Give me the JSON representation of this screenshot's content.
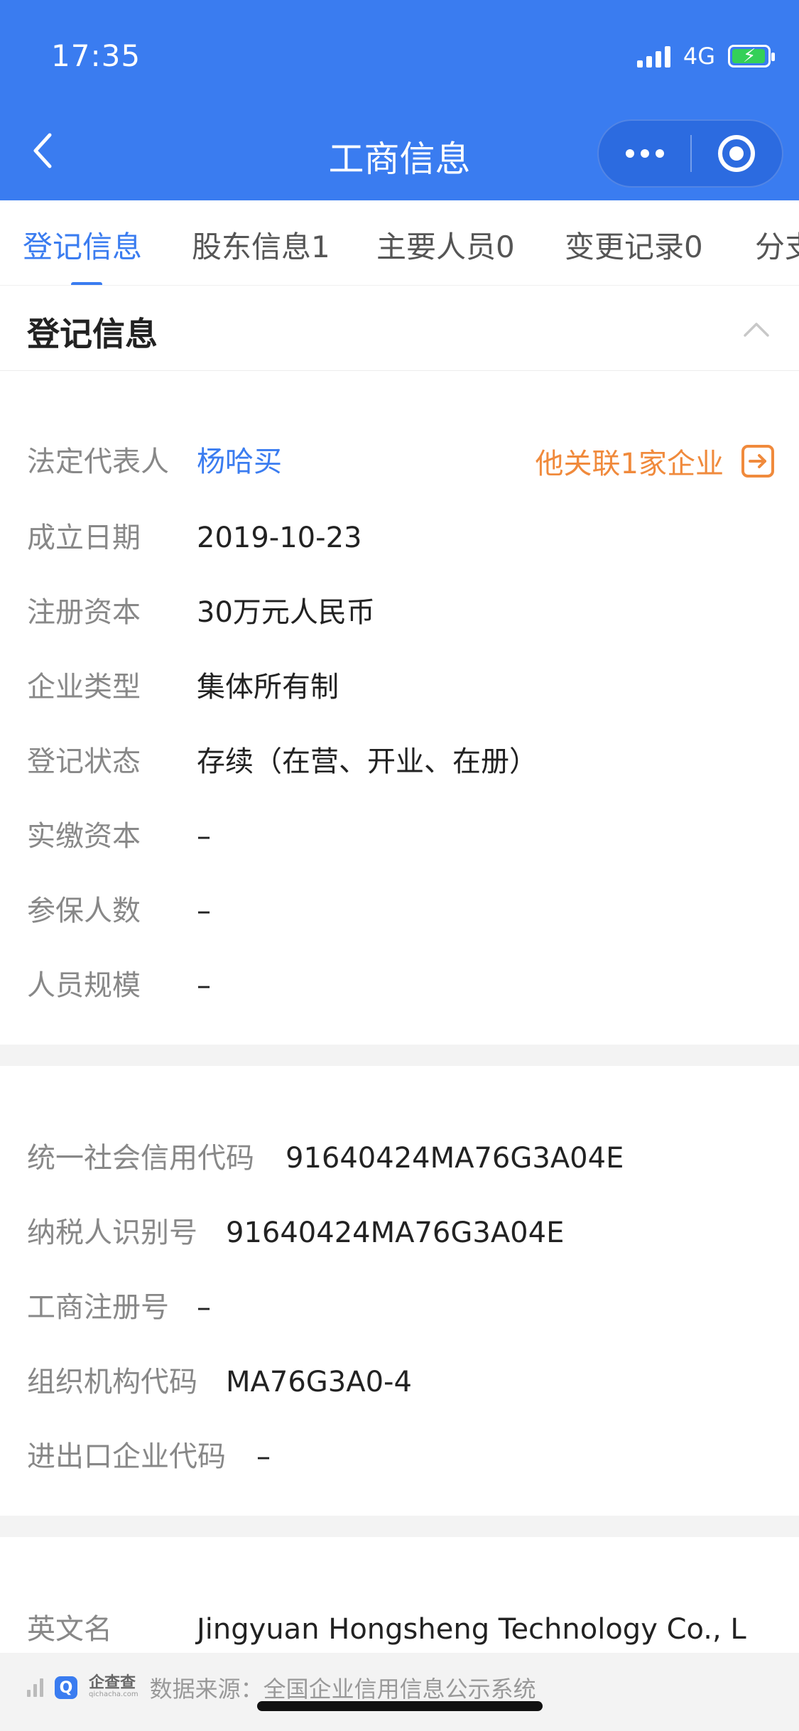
{
  "status": {
    "time": "17:35",
    "network": "4G"
  },
  "nav": {
    "title": "工商信息"
  },
  "tabs": [
    {
      "label": "登记信息"
    },
    {
      "label": "股东信息1"
    },
    {
      "label": "主要人员0"
    },
    {
      "label": "变更记录0"
    },
    {
      "label": "分支"
    }
  ],
  "section": {
    "title": "登记信息"
  },
  "registration": {
    "legal_rep_label": "法定代表人",
    "legal_rep_value": "杨哈买",
    "related_link": "他关联1家企业",
    "found_date_label": "成立日期",
    "found_date_value": "2019-10-23",
    "capital_label": "注册资本",
    "capital_value": "30万元人民币",
    "type_label": "企业类型",
    "type_value": "集体所有制",
    "status_label": "登记状态",
    "status_value": "存续（在营、开业、在册）",
    "paid_label": "实缴资本",
    "paid_value": "–",
    "insured_label": "参保人数",
    "insured_value": "–",
    "scale_label": "人员规模",
    "scale_value": "–"
  },
  "codes": {
    "credit_label": "统一社会信用代码",
    "credit_value": "91640424MA76G3A04E",
    "tax_label": "纳税人识别号",
    "tax_value": "91640424MA76G3A04E",
    "reg_no_label": "工商注册号",
    "reg_no_value": "–",
    "org_label": "组织机构代码",
    "org_value": "MA76G3A0-4",
    "ie_label": "进出口企业代码",
    "ie_value": "–"
  },
  "english": {
    "label": "英文名",
    "value": "Jingyuan Hongsheng Technology Co., L"
  },
  "footer": {
    "logo_text": "企查查",
    "logo_sub": "qichacha.com",
    "source": "数据来源：全国企业信用信息公示系统"
  },
  "colors": {
    "brand": "#3a7cf0",
    "accent": "#f08a3c"
  }
}
